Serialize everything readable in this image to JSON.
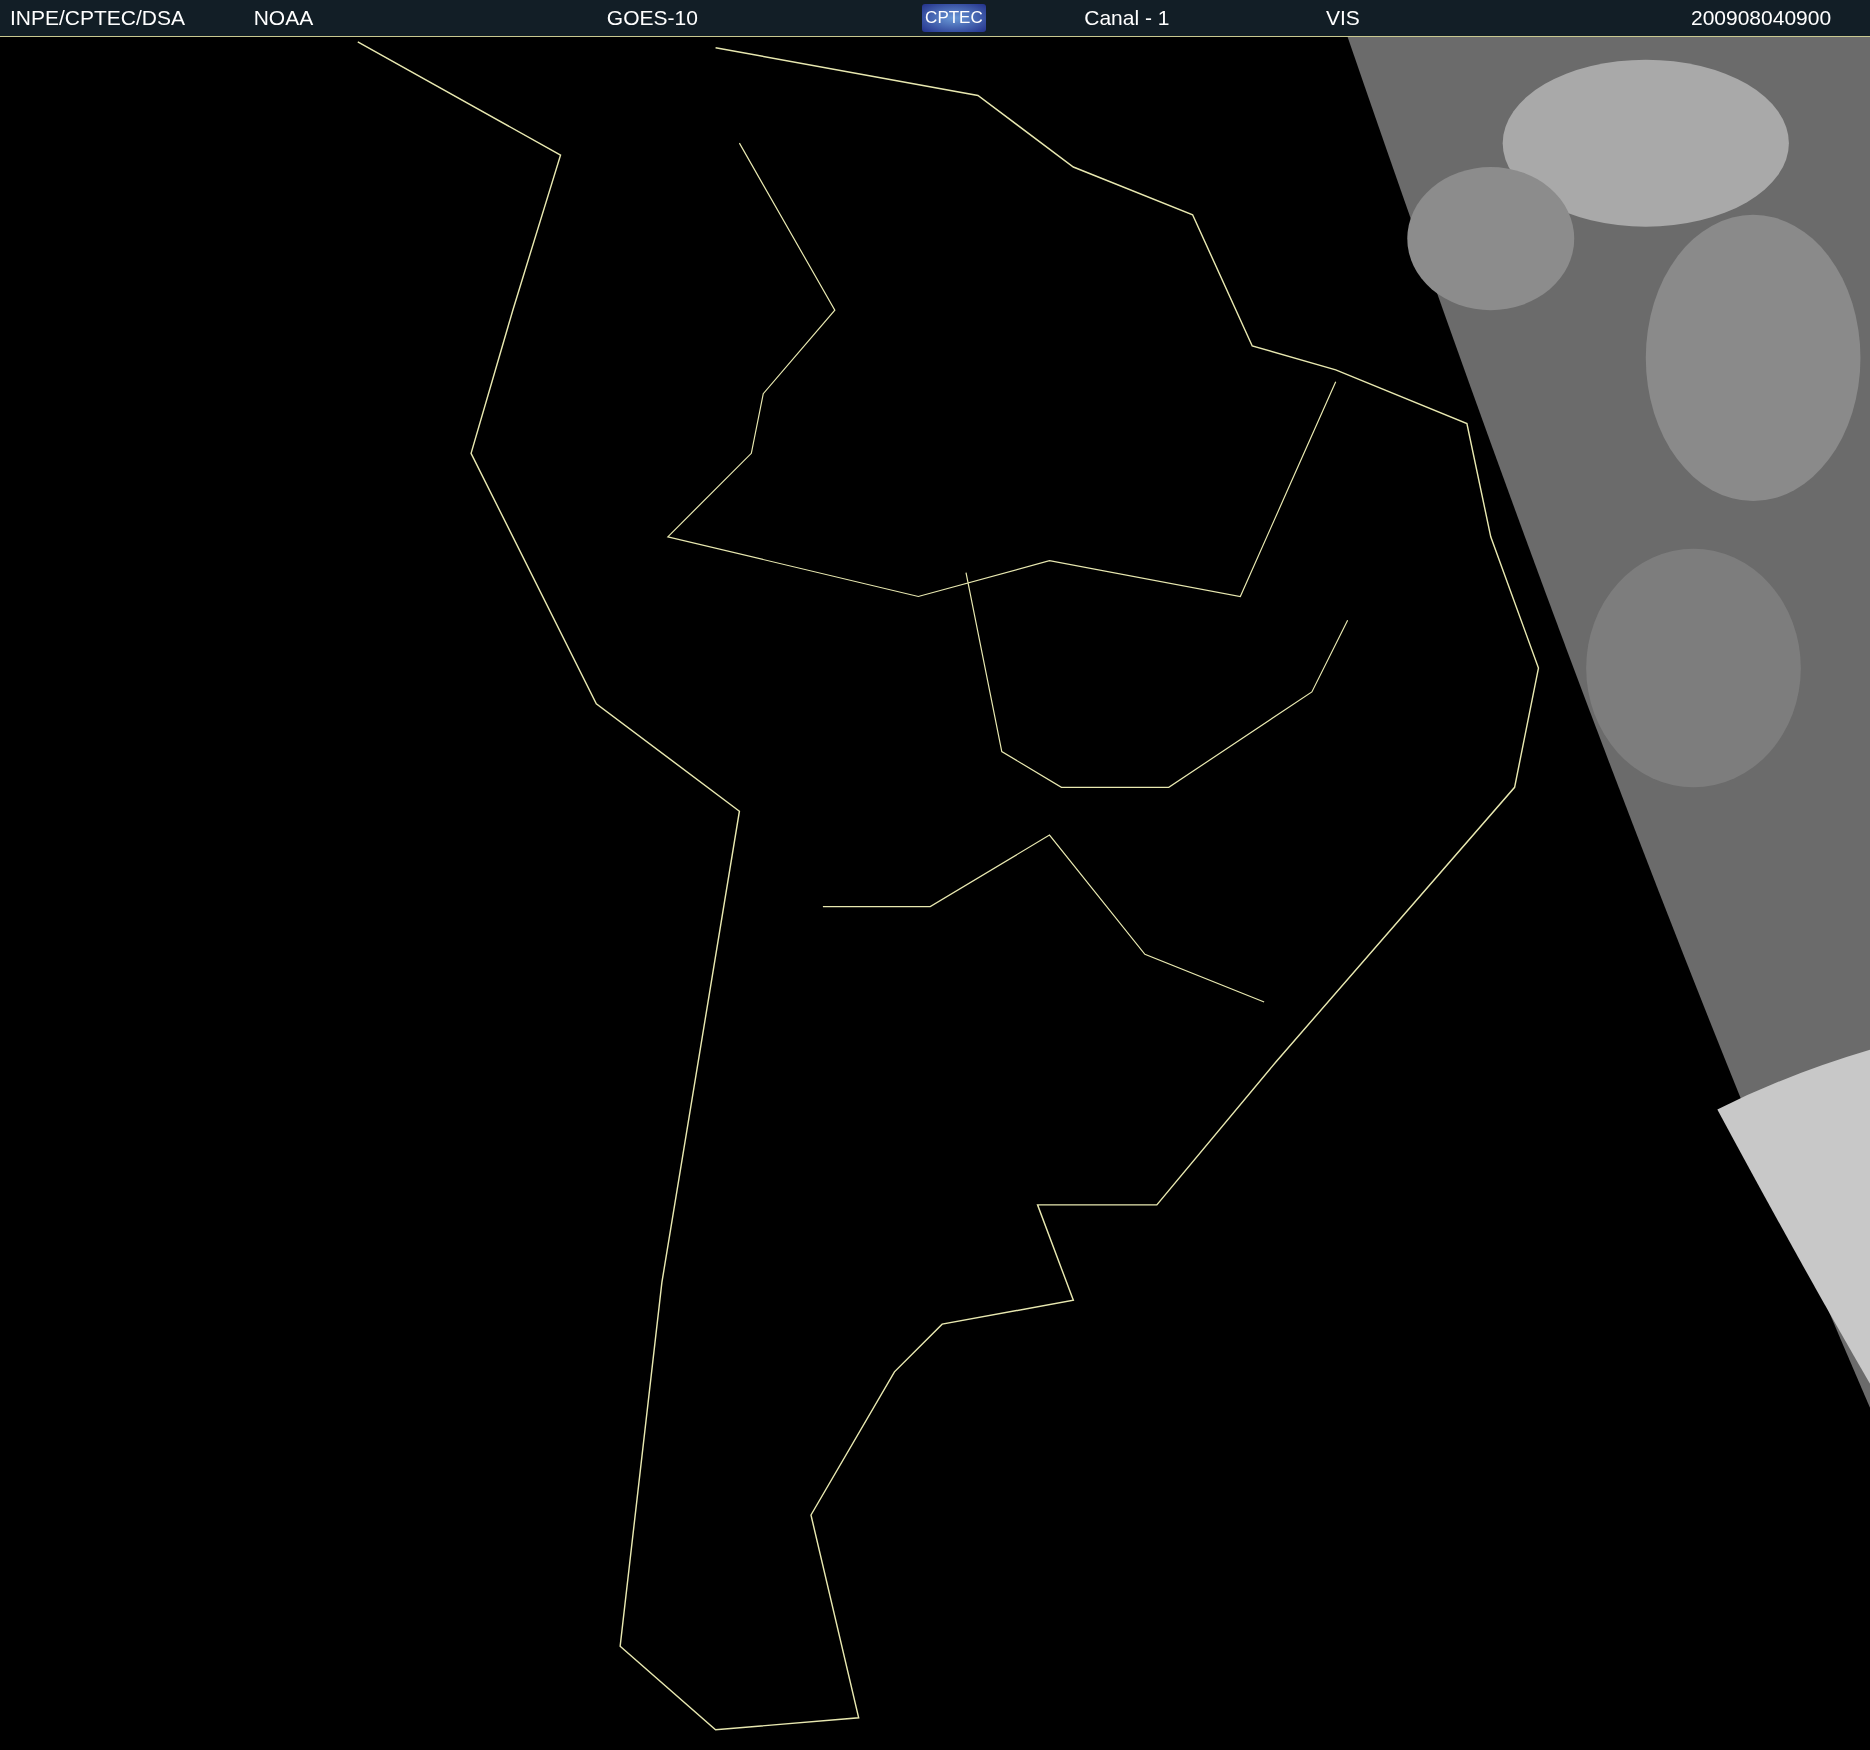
{
  "header": {
    "items": [
      {
        "kind": "text",
        "text": "INPE/CPTEC/DSA"
      },
      {
        "kind": "text",
        "text": "NOAA"
      },
      {
        "kind": "text",
        "text": "GOES-10"
      },
      {
        "kind": "logo",
        "text": "CPTEC"
      },
      {
        "kind": "text",
        "text": "Canal - 1"
      },
      {
        "kind": "text",
        "text": "VIS"
      },
      {
        "kind": "text",
        "text": "200908040900"
      }
    ]
  }
}
